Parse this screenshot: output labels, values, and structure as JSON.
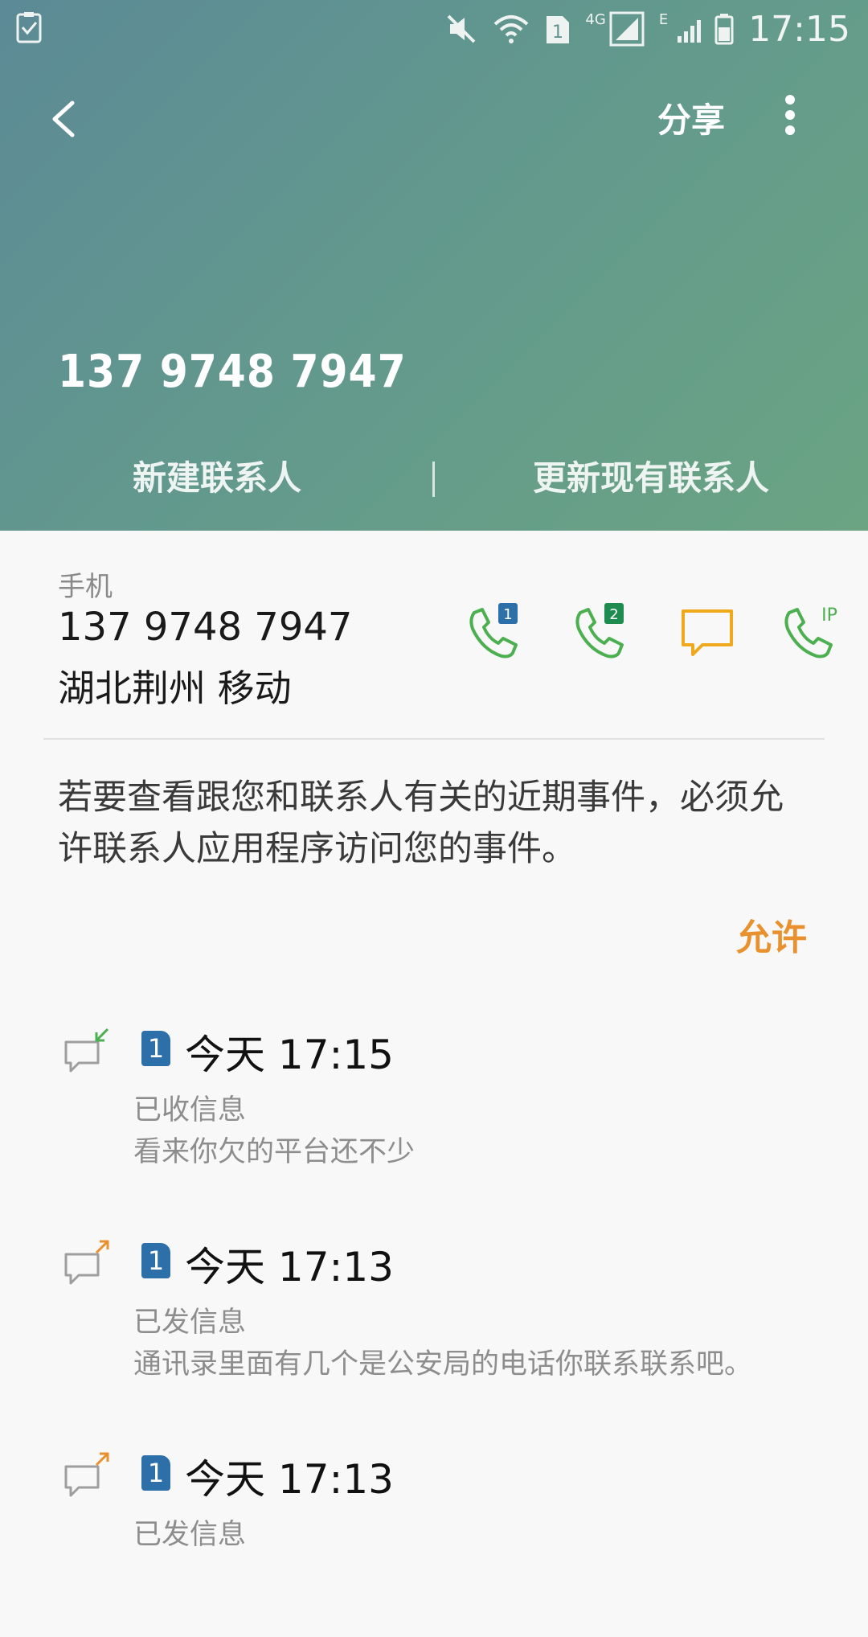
{
  "status_bar": {
    "time": "17:15",
    "network_4g": "4G",
    "network_e": "E",
    "sim_badge": "1"
  },
  "toolbar": {
    "share_label": "分享"
  },
  "header": {
    "number": "137 9748 7947",
    "new_contact_label": "新建联系人",
    "update_contact_label": "更新现有联系人"
  },
  "detail": {
    "label": "手机",
    "number": "137 9748 7947",
    "location": "湖北荆州 移动",
    "call_sim1_badge": "1",
    "call_sim2_badge": "2",
    "ip_call_label": "IP"
  },
  "notice": {
    "text": "若要查看跟您和联系人有关的近期事件，必须允许联系人应用程序访问您的事件。",
    "allow_label": "允许"
  },
  "logs": [
    {
      "sim": "1",
      "time": "今天 17:15",
      "type": "已收信息",
      "message": "看来你欠的平台还不少",
      "direction": "incoming"
    },
    {
      "sim": "1",
      "time": "今天 17:13",
      "type": "已发信息",
      "message": "通讯录里面有几个是公安局的电话你联系联系吧。",
      "direction": "outgoing"
    },
    {
      "sim": "1",
      "time": "今天 17:13",
      "type": "已发信息",
      "message": "",
      "direction": "outgoing"
    }
  ],
  "colors": {
    "call_green": "#4caf50",
    "sim2_green": "#1e8c4f",
    "message_orange": "#f0a81c",
    "allow_orange": "#e8912e",
    "sim_blue": "#2d6fa8"
  }
}
